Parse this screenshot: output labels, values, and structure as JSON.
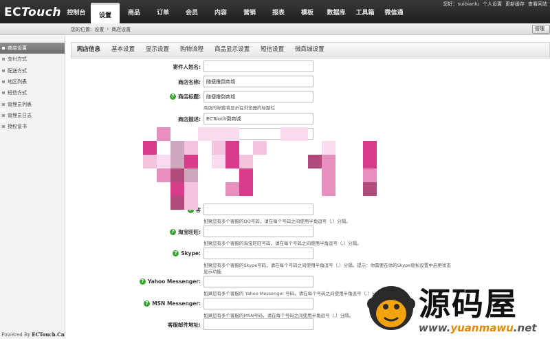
{
  "app": {
    "logo_prefix": "EC",
    "logo_suffix": "Touch"
  },
  "nav": {
    "items": [
      "控制台",
      "设置",
      "商品",
      "订单",
      "会员",
      "内容",
      "营销",
      "报表",
      "模板",
      "数据库",
      "工具箱",
      "微信通"
    ],
    "active_index": 1
  },
  "top_right": {
    "greeting": "您好：suibianlu",
    "links": [
      "个人设置",
      "更新缓存",
      "查看网站"
    ]
  },
  "breadcrumb": {
    "prefix": "您的位置:",
    "items": [
      "设置",
      "商店设置"
    ],
    "separator": "›"
  },
  "manage_button": "管理",
  "sidebar": {
    "items": [
      "商店设置",
      "支付方式",
      "配送方式",
      "地区列表",
      "短信方式",
      "管理员列表",
      "管理员日志",
      "授权证书"
    ],
    "active_index": 0,
    "powered_prefix": "Powered By ",
    "powered_brand": "ECTouch.Cn"
  },
  "tabs": {
    "items": [
      "网店信息",
      "基本设置",
      "显示设置",
      "购物流程",
      "商品显示设置",
      "短信设置",
      "微商城设置"
    ],
    "active_index": 0
  },
  "form": {
    "sender_name": {
      "label": "寄件人姓名:",
      "value": ""
    },
    "shop_name": {
      "label": "商店名称:",
      "value": "随便撸倒商城"
    },
    "shop_title": {
      "label": "商店标题:",
      "value": "随便撸倒商城",
      "hint": "商店的标题将显示在浏览器的标题栏"
    },
    "shop_desc": {
      "label": "商店描述:",
      "value": "ECTouch倒商城"
    },
    "qq": {
      "label": "客",
      "hint": "如果您有多个客服的QQ号码，请在每个号码之间使用半角逗号（,）分隔。"
    },
    "taobao": {
      "label": "淘宝旺旺:",
      "value": "",
      "hint": "如果您有多个客服的淘宝旺旺号码，请在每个号码之间使用半角逗号（,）分隔。"
    },
    "skype": {
      "label": "Skype:",
      "value": "",
      "hint": "如果您有多个客服的Skype号码，请在每个号码之间使用半角逗号（,）分隔。提示：你需要在你的Skype隐私设置中启用状态",
      "hint2": "显示功能"
    },
    "yahoo": {
      "label": "Yahoo Messenger:",
      "value": "",
      "hint": "如果您有多个客服的 Yahoo Messenger 号码，请在每个号码之间使用半角逗号（,）分隔。"
    },
    "msn": {
      "label": "MSN Messenger:",
      "value": "",
      "hint": "如果您有多个客服的MSN号码，请在每个号码之间使用半角逗号（,）分隔。"
    },
    "service_email": {
      "label": "客服邮件地址:",
      "value": ""
    }
  },
  "watermark": {
    "cn": "源码屋",
    "url_part1": "www.",
    "url_highlight": "yuanmawu",
    "url_part2": ".net"
  },
  "colors": {
    "topbar": "#2b2b2b",
    "help_icon": "#3aa535",
    "mosaic": [
      "#d63c8a",
      "#e68fc0",
      "#f4c4dc",
      "#b24a7c",
      "#cfa7bd",
      "#f8dcee"
    ]
  }
}
